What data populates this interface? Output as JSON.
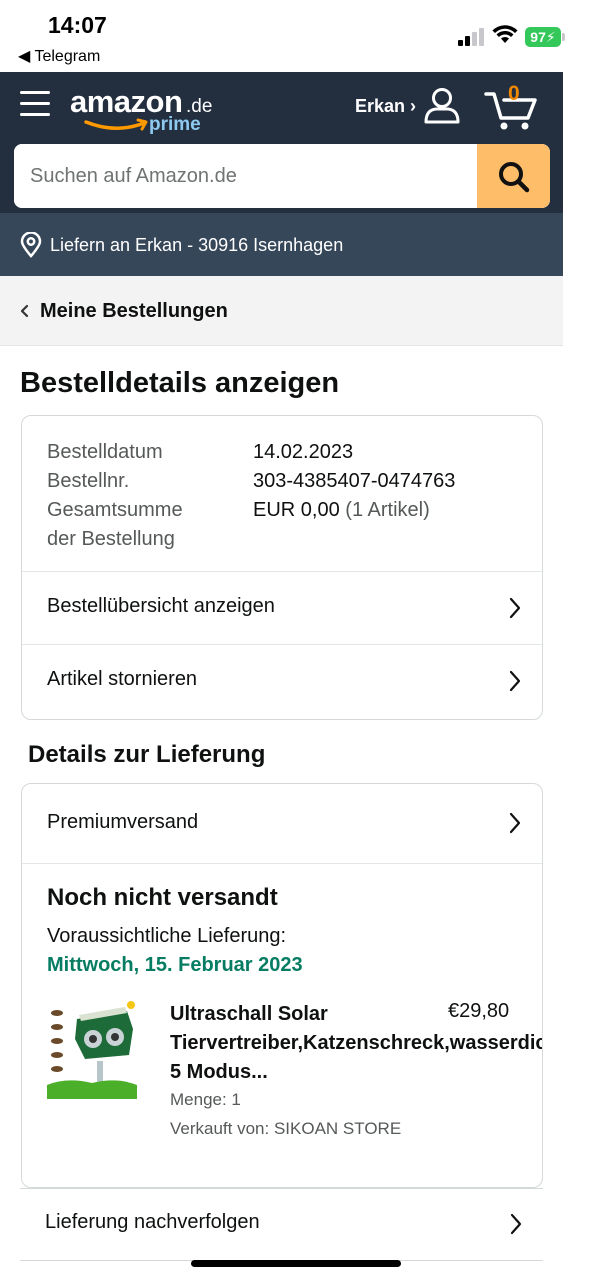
{
  "status_bar": {
    "time": "14:07",
    "back_app": "◀ Telegram",
    "battery": "97"
  },
  "header": {
    "logo_word": "amazon",
    "logo_tld": ".de",
    "logo_sub": "prime",
    "account_label": "Erkan ›",
    "cart_count": "0"
  },
  "search": {
    "placeholder": "Suchen auf Amazon.de"
  },
  "deliver": {
    "text": "Liefern an Erkan - 30916 Isernhagen"
  },
  "breadcrumb": {
    "label": "Meine Bestellungen"
  },
  "page": {
    "title": "Bestelldetails anzeigen"
  },
  "order": {
    "date_label": "Bestelldatum",
    "date_value": "14.02.2023",
    "number_label": "Bestellnr.",
    "number_value": "303-4385407-0474763",
    "total_label_1": "Gesamtsumme",
    "total_label_2": "der Bestellung",
    "total_value": "EUR 0,00",
    "total_items": "(1 Artikel)",
    "links": [
      {
        "label": "Bestellübersicht anzeigen"
      },
      {
        "label": "Artikel stornieren"
      }
    ]
  },
  "delivery": {
    "section_title": "Details zur Lieferung",
    "shipping_method": "Premiumversand",
    "status": "Noch nicht versandt",
    "eta_label": "Voraussichtliche Lieferung:",
    "eta_date": "Mittwoch, 15. Februar 2023",
    "product": {
      "title_line_1": "Ultraschall Solar",
      "title_line_2": "Tiervertreiber,Katzenschreck,wasserdicht",
      "title_line_3": "5 Modus...",
      "price": "€29,80",
      "quantity": "Menge: 1",
      "seller": "Verkauft von: SIKOAN STORE"
    },
    "track_label": "Lieferung nachverfolgen"
  },
  "colors": {
    "header_bg": "#232f3e",
    "deliver_bg": "#37475a",
    "search_button": "#febd69",
    "cart_count": "#f08804",
    "eta_green": "#067d62",
    "battery_green": "#34c759"
  }
}
